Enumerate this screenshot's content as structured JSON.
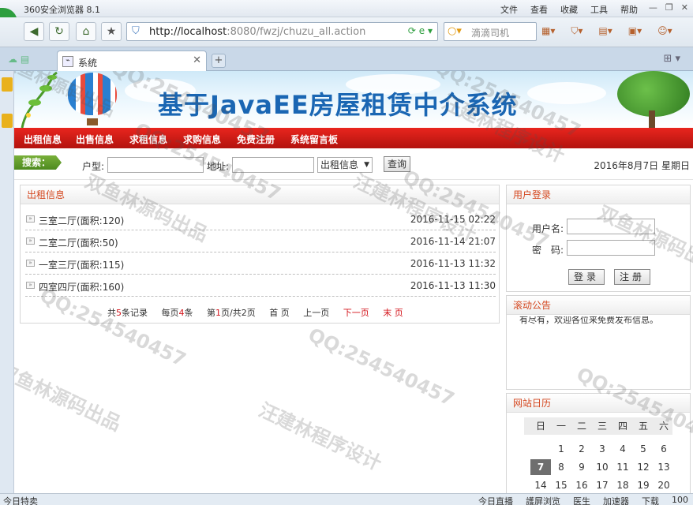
{
  "browser": {
    "app_title": "360安全浏览器 8.1",
    "menu": [
      "文件",
      "查看",
      "收藏",
      "工具",
      "帮助"
    ],
    "url_host": "http://localhost",
    "url_path": ":8080/fwzj/chuzu_all.action",
    "search_text": "滴滴司机",
    "tab_label": "系统",
    "status_left": "今日特卖",
    "status_items": [
      "今日直播",
      "護屏浏览",
      "医生",
      "加速器",
      "下载",
      "100"
    ]
  },
  "site": {
    "title": "基于JavaEE房屋租赁中介系统",
    "nav": [
      "出租信息",
      "出售信息",
      "求租信息",
      "求购信息",
      "免费注册",
      "系统留言板"
    ]
  },
  "search": {
    "tag": "搜索：",
    "type_label": "户型:",
    "address_label": "地址:",
    "category": "出租信息",
    "button": "查询",
    "date": "2016年8月7日 星期日"
  },
  "rental": {
    "title": "出租信息",
    "items": [
      {
        "title": "三室二厅(面积:120)",
        "date": "2016-11-15 02:22"
      },
      {
        "title": "二室二厅(面积:50)",
        "date": "2016-11-14 21:07"
      },
      {
        "title": "一室三厅(面积:115)",
        "date": "2016-11-13 11:32"
      },
      {
        "title": "四室四厅(面积:160)",
        "date": "2016-11-13 11:30"
      }
    ],
    "pager": {
      "total_prefix": "共",
      "total": "5",
      "total_suffix": "条记录",
      "per_prefix": "每页",
      "per": "4",
      "per_suffix": "条",
      "page_prefix": "第",
      "page": "1",
      "page_suffix": "页/共2页",
      "first": "首 页",
      "prev": "上一页",
      "next": "下一页",
      "last": "末 页"
    }
  },
  "login": {
    "title": "用户登录",
    "username_label": "用户名:",
    "password_label": "密　码:",
    "login_button": "登录",
    "register_button": "注册"
  },
  "notice": {
    "title": "滚动公告",
    "text": "有尽有，欢迎各位来免费发布信息。"
  },
  "calendar": {
    "title": "网站日历",
    "weekdays": [
      "日",
      "一",
      "二",
      "三",
      "四",
      "五",
      "六"
    ],
    "rows": [
      [
        "",
        "1",
        "2",
        "3",
        "4",
        "5",
        "6"
      ],
      [
        "7",
        "8",
        "9",
        "10",
        "11",
        "12",
        "13"
      ],
      [
        "14",
        "15",
        "16",
        "17",
        "18",
        "19",
        "20"
      ]
    ],
    "today": "7"
  },
  "watermarks": [
    "QQ:254540457",
    "汪建林程序设计",
    "双鱼林源码出品"
  ]
}
